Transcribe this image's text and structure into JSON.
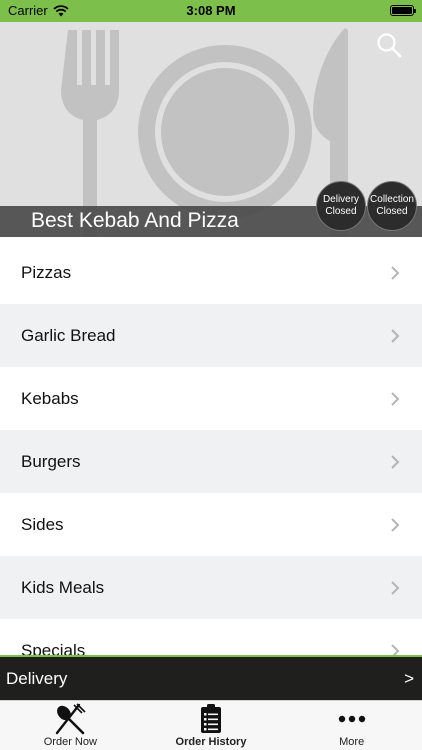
{
  "status_bar": {
    "carrier": "Carrier",
    "time": "3:08 PM"
  },
  "restaurant": {
    "name": "Best Kebab And Pizza"
  },
  "delivery_status": {
    "line1": "Delivery",
    "line2": "Closed"
  },
  "collection_status": {
    "line1": "Collection",
    "line2": "Closed"
  },
  "menu": {
    "categories": [
      {
        "label": "Pizzas"
      },
      {
        "label": "Garlic Bread"
      },
      {
        "label": "Kebabs"
      },
      {
        "label": "Burgers"
      },
      {
        "label": "Sides"
      },
      {
        "label": "Kids Meals"
      },
      {
        "label": "Specials"
      }
    ]
  },
  "order_bar": {
    "mode": "Delivery",
    "arrow": ">"
  },
  "tabs": [
    {
      "label": "Order Now",
      "icon": "fork-knife-icon"
    },
    {
      "label": "Order History",
      "icon": "clipboard-list-icon"
    },
    {
      "label": "More",
      "icon": "more-dots-icon"
    }
  ],
  "colors": {
    "accent": "#7cc04b",
    "dark_bar": "#1f1f1d",
    "alt_row": "#f0f1f3"
  }
}
